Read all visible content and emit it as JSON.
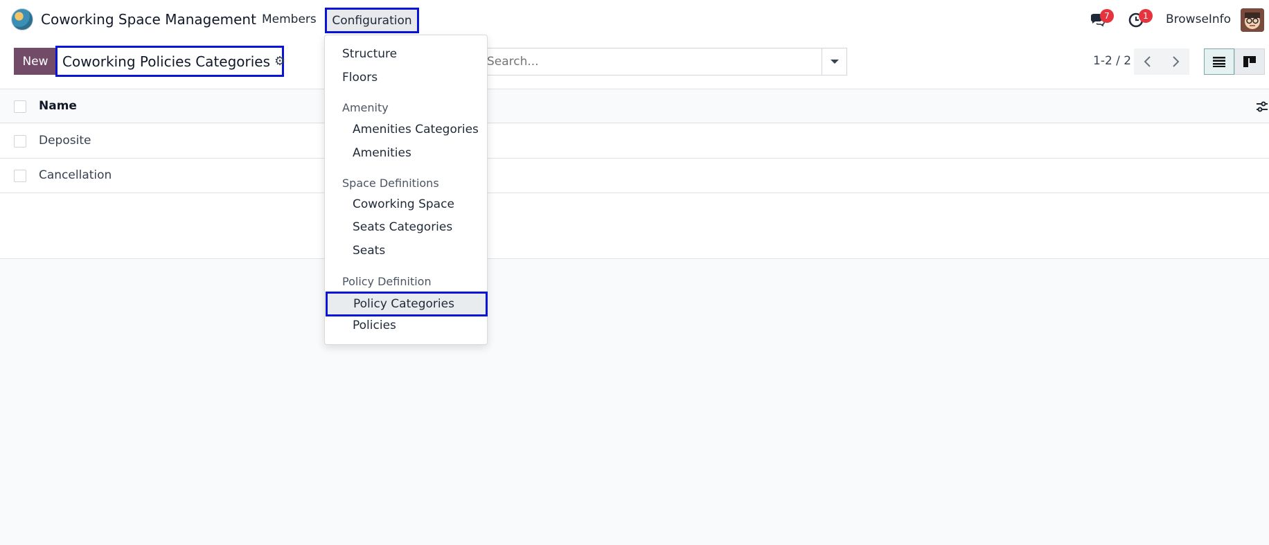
{
  "navbar": {
    "app_name": "Coworking Space Management",
    "menu_members": "Members",
    "menu_configuration": "Configuration",
    "chat_badge": "7",
    "activity_badge": "1",
    "user_name": "BrowseInfo"
  },
  "control_panel": {
    "new_label": "New",
    "breadcrumb_title": "Coworking Policies Categories",
    "search_placeholder": "Search...",
    "pager": "1-2 / 2"
  },
  "list": {
    "header_name": "Name",
    "rows": [
      "Deposite",
      "Cancellation"
    ]
  },
  "dropdown": {
    "structure": "Structure",
    "floors": "Floors",
    "amenity_header": "Amenity",
    "amenities_categories": "Amenities Categories",
    "amenities": "Amenities",
    "space_definitions_header": "Space Definitions",
    "coworking_space": "Coworking Space",
    "seats_categories": "Seats Categories",
    "seats": "Seats",
    "policy_definition_header": "Policy Definition",
    "policy_categories": "Policy Categories",
    "policies": "Policies"
  },
  "colors": {
    "primary": "#714b67",
    "highlight_border": "#0a14d8",
    "badge": "#e5343d"
  }
}
